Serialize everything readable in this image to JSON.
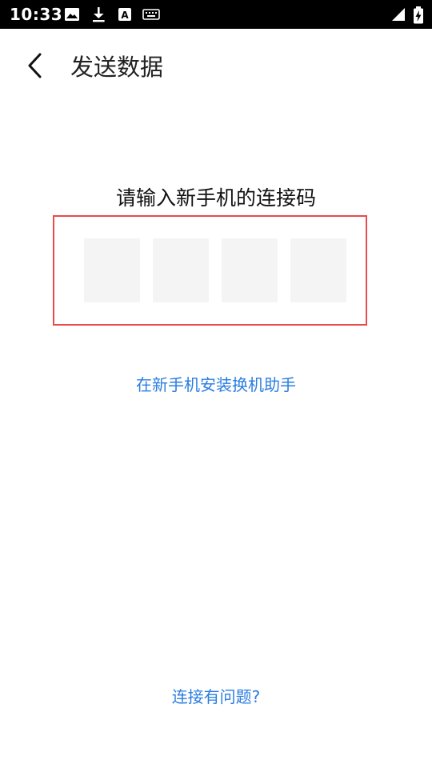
{
  "status_bar": {
    "time": "10:33",
    "left_icons": [
      "image-icon",
      "download-icon",
      "font-a-icon",
      "keyboard-icon"
    ],
    "right_icons": [
      "signal-icon",
      "battery-charging-icon"
    ]
  },
  "app_bar": {
    "title": "发送数据",
    "back_icon": "chevron-left-icon"
  },
  "main": {
    "prompt": "请输入新手机的连接码",
    "code_boxes": [
      "",
      "",
      "",
      ""
    ],
    "install_link": "在新手机安装换机助手",
    "help_link": "连接有问题?"
  },
  "colors": {
    "accent": "#2a7de1",
    "highlight_border": "#e94b4b",
    "box_fill": "#f4f4f4"
  }
}
